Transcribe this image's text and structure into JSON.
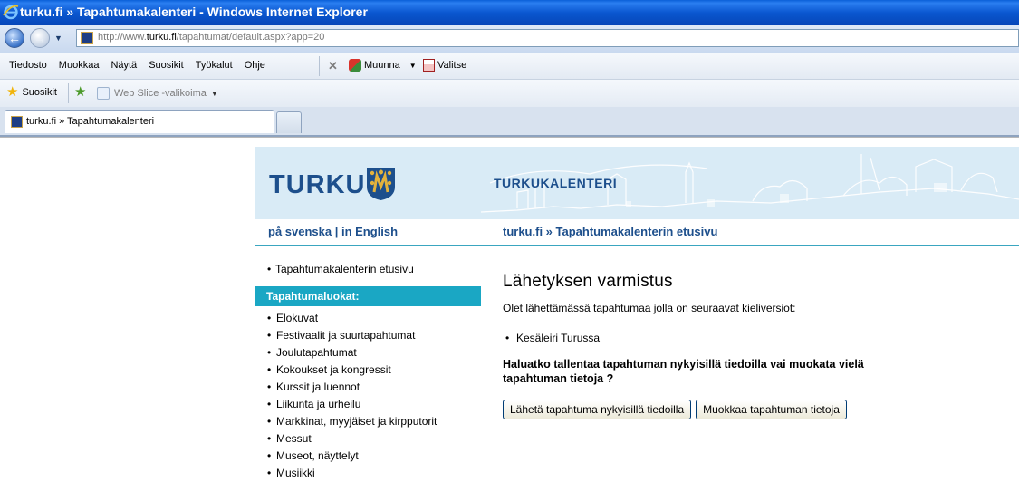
{
  "window": {
    "title": "turku.fi » Tapahtumakalenteri - Windows Internet Explorer"
  },
  "address": {
    "url_prefix": "http://www.",
    "url_domain": "turku.fi",
    "url_path": "/tapahtumat/default.aspx?app=20"
  },
  "menu": {
    "items": [
      "Tiedosto",
      "Muokkaa",
      "Näytä",
      "Suosikit",
      "Työkalut",
      "Ohje"
    ],
    "muunna_label": "Muunna",
    "valitse_label": "Valitse"
  },
  "favorites": {
    "suosikit_label": "Suosikit",
    "webslice_label": "Web Slice -valikoima"
  },
  "tab": {
    "label": "turku.fi » Tapahtumakalenteri"
  },
  "banner": {
    "logo_text": "TURKU",
    "calendar_title": "TURKUKALENTERI"
  },
  "navstrip": {
    "languages": "på svenska | in English",
    "breadcrumb": "turku.fi » Tapahtumakalenterin etusivu"
  },
  "sidebar": {
    "home_link": "Tapahtumakalenterin etusivu",
    "categories_heading": "Tapahtumaluokat:",
    "categories": [
      "Elokuvat",
      "Festivaalit ja suurtapahtumat",
      "Joulutapahtumat",
      "Kokoukset ja kongressit",
      "Kurssit ja luennot",
      "Liikunta ja urheilu",
      "Markkinat, myyjäiset ja kirpputorit",
      "Messut",
      "Museot, näyttelyt",
      "Musiikki"
    ]
  },
  "main": {
    "heading": "Lähetyksen varmistus",
    "intro": "Olet lähettämässä tapahtumaa jolla on seuraavat kieliversiot:",
    "versions": [
      "Kesäleiri Turussa"
    ],
    "question": "Haluatko tallentaa tapahtuman nykyisillä tiedoilla vai muokata vielä tapahtuman tietoja ?",
    "send_button": "Lähetä tapahtuma nykyisillä tiedoilla",
    "edit_button": "Muokkaa tapahtuman tietoja"
  }
}
